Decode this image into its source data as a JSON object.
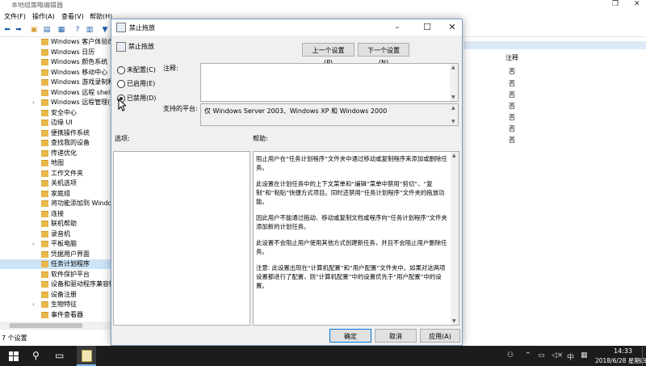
{
  "background_window": {
    "title": "本地组策略编辑器",
    "menu": [
      "文件(F)",
      "操作(A)",
      "查看(V)",
      "帮助(H)"
    ],
    "tree_items": [
      {
        "label": "Windows 客户体验改",
        "expand": false
      },
      {
        "label": "Windows 日历",
        "expand": false
      },
      {
        "label": "Windows 颜色系统",
        "expand": false
      },
      {
        "label": "Windows 移动中心",
        "expand": false
      },
      {
        "label": "Windows 游戏录制和",
        "expand": false
      },
      {
        "label": "Windows 远程 shell",
        "expand": false
      },
      {
        "label": "Windows 远程管理(W",
        "expand": true
      },
      {
        "label": "安全中心",
        "expand": false
      },
      {
        "label": "边缘 UI",
        "expand": false
      },
      {
        "label": "便携操作系统",
        "expand": false
      },
      {
        "label": "查找我的设备",
        "expand": false
      },
      {
        "label": "传递优化",
        "expand": false
      },
      {
        "label": "地图",
        "expand": false
      },
      {
        "label": "工作文件夹",
        "expand": false
      },
      {
        "label": "关机选项",
        "expand": false
      },
      {
        "label": "家庭组",
        "expand": false
      },
      {
        "label": "将功能添加到 Windov",
        "expand": false
      },
      {
        "label": "连接",
        "expand": false
      },
      {
        "label": "联机帮助",
        "expand": false
      },
      {
        "label": "录音机",
        "expand": false
      },
      {
        "label": "平板电脑",
        "expand": true
      },
      {
        "label": "凭据用户界面",
        "expand": false
      },
      {
        "label": "任务计划程序",
        "expand": false,
        "selected": true
      },
      {
        "label": "软件保护平台",
        "expand": false
      },
      {
        "label": "设备和驱动程序兼容性",
        "expand": false
      },
      {
        "label": "设备注册",
        "expand": false
      },
      {
        "label": "生物特征",
        "expand": true
      },
      {
        "label": "事件查看器",
        "expand": false
      }
    ],
    "status": "7 个设置",
    "column_header": "注释",
    "notes": [
      "否",
      "否",
      "否",
      "否",
      "否",
      "否",
      "否"
    ]
  },
  "dialog": {
    "title": "禁止拖放",
    "setting_name": "禁止拖放",
    "prev_button": "上一个设置(P)",
    "next_button": "下一个设置(N)",
    "radio_not_configured": "未配置(C)",
    "radio_enabled": "已启用(E)",
    "radio_disabled": "已禁用(D)",
    "selected_radio": "disabled",
    "comment_label": "注释:",
    "supported_label": "支持的平台:",
    "supported_value": "仅 Windows Server 2003、Windows XP 和 Windows 2000",
    "options_label": "选项:",
    "help_label": "帮助:",
    "help_paragraphs": [
      "阻止用户在“任务计划程序”文件夹中通过移动或复制程序来添加或删除任务。",
      "此设置在计划任务中的上下文菜单和“编辑”菜单中禁用“剪切”、“复制”和“粘贴”快捷方式项目。同时还禁用“任务计划程序”文件夹的拖放功能。",
      "因此用户不能通过拖动、移动或复制文档或程序向“任务计划程序”文件夹添加新的计划任务。",
      "此设置不会阻止用户使用其他方式创建新任务，并且不会阻止用户删除任务。",
      "注意: 此设置出现在“计算机配置”和“用户配置”文件夹中。如果对这两项设置都进行了配置，则“计算机配置”中的设置优先于“用户配置”中的设置。"
    ],
    "ok_button": "确定",
    "cancel_button": "取消",
    "apply_button": "应用(A)"
  },
  "taskbar": {
    "time": "14:33",
    "date": "2018/6/28 星期四",
    "ime": "中"
  }
}
